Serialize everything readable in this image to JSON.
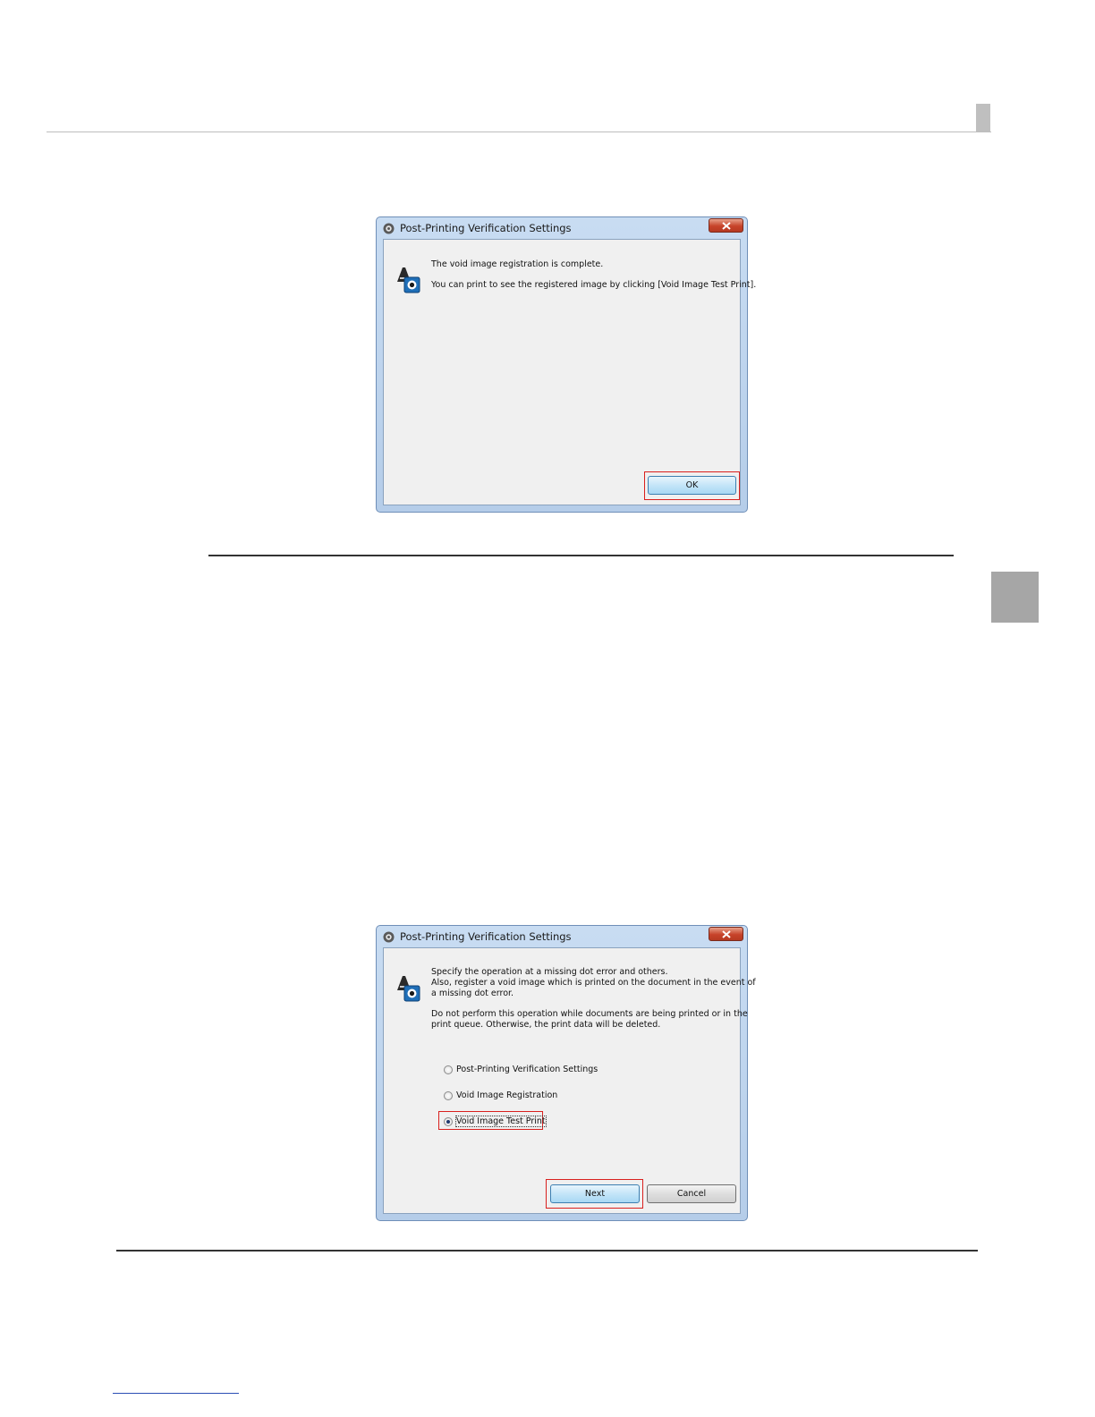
{
  "dialog1": {
    "title": "Post-Printing Verification Settings",
    "lines": [
      "The void image registration is complete.",
      "You can print to see the registered image by clicking [Void Image Test Print]."
    ],
    "ok_label": "OK"
  },
  "dialog2": {
    "title": "Post-Printing Verification Settings",
    "paragraph1": [
      "Specify the operation at a missing dot error and others.",
      "Also, register a void image which is printed on the document in the event of",
      "a missing dot error."
    ],
    "paragraph2": [
      "Do not perform this operation while documents are being printed or in the",
      "print queue. Otherwise, the print data will be deleted."
    ],
    "options": [
      {
        "label": "Post-Printing Verification Settings",
        "checked": false
      },
      {
        "label": "Void Image Registration",
        "checked": false
      },
      {
        "label": "Void Image Test Print",
        "checked": true
      }
    ],
    "next_label": "Next",
    "cancel_label": "Cancel"
  },
  "colors": {
    "highlight": "#d9201e",
    "side_tab": "#a6a6a6"
  }
}
